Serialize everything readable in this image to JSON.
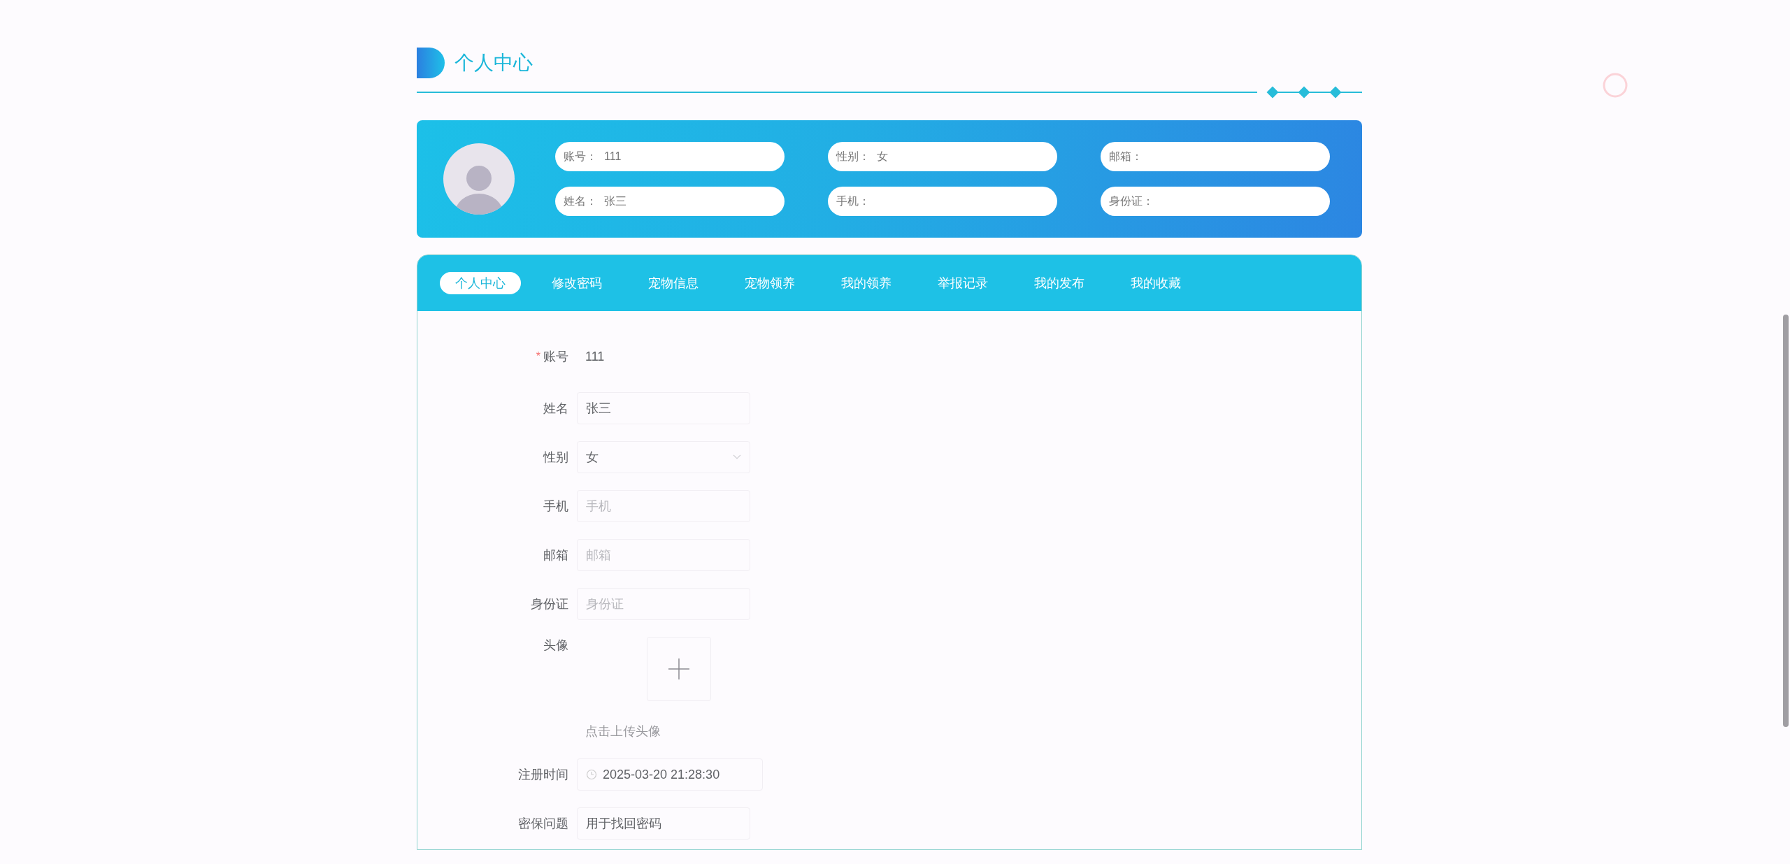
{
  "page_title": "个人中心",
  "profile_card": {
    "fields": [
      {
        "label": "账号：",
        "value": "111"
      },
      {
        "label": "性别：",
        "value": "女"
      },
      {
        "label": "邮箱："
      },
      {
        "label": "姓名：",
        "value": "张三"
      },
      {
        "label": "手机："
      },
      {
        "label": "身份证："
      }
    ]
  },
  "tabs": [
    {
      "label": "个人中心",
      "selected": true
    },
    {
      "label": "修改密码",
      "selected": false
    },
    {
      "label": "宠物信息",
      "selected": false
    },
    {
      "label": "宠物领养",
      "selected": false
    },
    {
      "label": "我的领养",
      "selected": false
    },
    {
      "label": "举报记录",
      "selected": false
    },
    {
      "label": "我的发布",
      "selected": false
    },
    {
      "label": "我的收藏",
      "selected": false
    }
  ],
  "form": {
    "rows": [
      {
        "kind": "static",
        "label": "账号",
        "required_mark": "*",
        "value": "111"
      },
      {
        "kind": "input",
        "label": "姓名",
        "value": "张三"
      },
      {
        "kind": "select",
        "label": "性别",
        "value": "女"
      },
      {
        "kind": "input",
        "label": "手机",
        "placeholder": "手机"
      },
      {
        "kind": "input",
        "label": "邮箱",
        "placeholder": "邮箱"
      },
      {
        "kind": "input",
        "label": "身份证",
        "placeholder": "身份证"
      },
      {
        "kind": "upload",
        "label": "头像",
        "hint": "点击上传头像"
      },
      {
        "kind": "datetime",
        "label": "注册时间",
        "value": "2025-03-20 21:28:30"
      },
      {
        "kind": "input",
        "label": "密保问题",
        "value": "用于找回密码"
      }
    ]
  }
}
